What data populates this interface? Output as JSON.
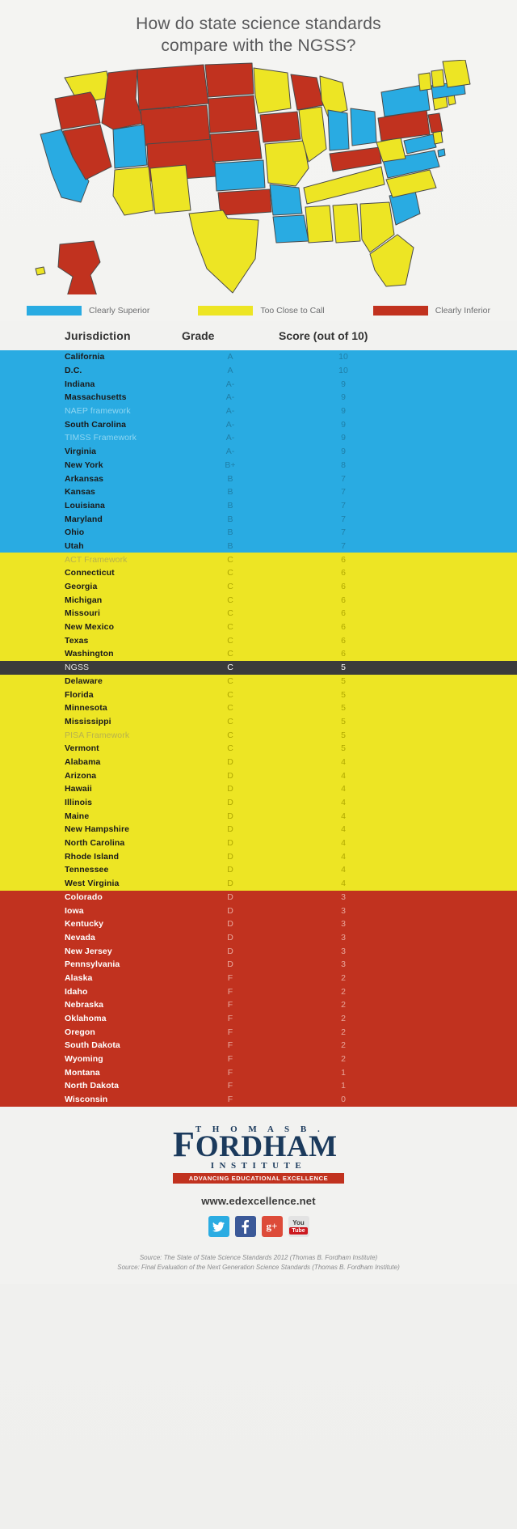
{
  "title": {
    "line1": "How do state science standards",
    "line2": "compare with the NGSS?"
  },
  "colors": {
    "superior": "#29ABE2",
    "close": "#EDE524",
    "inferior": "#C1321F",
    "ngss_row": "#3b3b3b",
    "background": "#f2f2f0"
  },
  "legend": {
    "items": [
      {
        "label": "Clearly Superior",
        "color": "#29ABE2"
      },
      {
        "label": "Too Close to Call",
        "color": "#EDE524"
      },
      {
        "label": "Clearly Inferior",
        "color": "#C1321F"
      }
    ]
  },
  "table": {
    "headers": {
      "jurisdiction": "Jurisdiction",
      "grade": "Grade",
      "score": "Score (out of 10)"
    }
  },
  "chart_data": {
    "type": "table",
    "title": "How do state science standards compare with the NGSS?",
    "columns": [
      "Jurisdiction",
      "Grade",
      "Score (out of 10)"
    ],
    "ylim": [
      0,
      10
    ],
    "legend": [
      "Clearly Superior",
      "Too Close to Call",
      "Clearly Inferior"
    ],
    "bands": [
      {
        "category": "Clearly Superior",
        "color": "#29ABE2",
        "rows": [
          {
            "name": "California",
            "grade": "A",
            "score": "10",
            "framework": false
          },
          {
            "name": "D.C.",
            "grade": "A",
            "score": "10",
            "framework": false
          },
          {
            "name": "Indiana",
            "grade": "A-",
            "score": "9",
            "framework": false
          },
          {
            "name": "Massachusetts",
            "grade": "A-",
            "score": "9",
            "framework": false
          },
          {
            "name": "NAEP framework",
            "grade": "A-",
            "score": "9",
            "framework": true
          },
          {
            "name": "South Carolina",
            "grade": "A-",
            "score": "9",
            "framework": false
          },
          {
            "name": "TIMSS Framework",
            "grade": "A-",
            "score": "9",
            "framework": true
          },
          {
            "name": "Virginia",
            "grade": "A-",
            "score": "9",
            "framework": false
          },
          {
            "name": "New York",
            "grade": "B+",
            "score": "8",
            "framework": false
          },
          {
            "name": "Arkansas",
            "grade": "B",
            "score": "7",
            "framework": false
          },
          {
            "name": "Kansas",
            "grade": "B",
            "score": "7",
            "framework": false
          },
          {
            "name": "Louisiana",
            "grade": "B",
            "score": "7",
            "framework": false
          },
          {
            "name": "Maryland",
            "grade": "B",
            "score": "7",
            "framework": false
          },
          {
            "name": "Ohio",
            "grade": "B",
            "score": "7",
            "framework": false
          },
          {
            "name": "Utah",
            "grade": "B",
            "score": "7",
            "framework": false
          }
        ]
      },
      {
        "category": "Too Close to Call",
        "color": "#EDE524",
        "rows": [
          {
            "name": "ACT Framework",
            "grade": "C",
            "score": "6",
            "framework": true
          },
          {
            "name": "Connecticut",
            "grade": "C",
            "score": "6",
            "framework": false
          },
          {
            "name": "Georgia",
            "grade": "C",
            "score": "6",
            "framework": false
          },
          {
            "name": "Michigan",
            "grade": "C",
            "score": "6",
            "framework": false
          },
          {
            "name": "Missouri",
            "grade": "C",
            "score": "6",
            "framework": false
          },
          {
            "name": "New Mexico",
            "grade": "C",
            "score": "6",
            "framework": false
          },
          {
            "name": "Texas",
            "grade": "C",
            "score": "6",
            "framework": false
          },
          {
            "name": "Washington",
            "grade": "C",
            "score": "6",
            "framework": false
          }
        ]
      },
      {
        "category": "NGSS",
        "color": "#3b3b3b",
        "highlight": true,
        "rows": [
          {
            "name": "NGSS",
            "grade": "C",
            "score": "5",
            "framework": true
          }
        ]
      },
      {
        "category": "Too Close to Call",
        "color": "#EDE524",
        "rows": [
          {
            "name": "Delaware",
            "grade": "C",
            "score": "5",
            "framework": false
          },
          {
            "name": "Florida",
            "grade": "C",
            "score": "5",
            "framework": false
          },
          {
            "name": "Minnesota",
            "grade": "C",
            "score": "5",
            "framework": false
          },
          {
            "name": "Mississippi",
            "grade": "C",
            "score": "5",
            "framework": false
          },
          {
            "name": "PISA Framework",
            "grade": "C",
            "score": "5",
            "framework": true
          },
          {
            "name": "Vermont",
            "grade": "C",
            "score": "5",
            "framework": false
          },
          {
            "name": "Alabama",
            "grade": "D",
            "score": "4",
            "framework": false
          },
          {
            "name": "Arizona",
            "grade": "D",
            "score": "4",
            "framework": false
          },
          {
            "name": "Hawaii",
            "grade": "D",
            "score": "4",
            "framework": false
          },
          {
            "name": "Illinois",
            "grade": "D",
            "score": "4",
            "framework": false
          },
          {
            "name": "Maine",
            "grade": "D",
            "score": "4",
            "framework": false
          },
          {
            "name": "New Hampshire",
            "grade": "D",
            "score": "4",
            "framework": false
          },
          {
            "name": "North Carolina",
            "grade": "D",
            "score": "4",
            "framework": false
          },
          {
            "name": "Rhode Island",
            "grade": "D",
            "score": "4",
            "framework": false
          },
          {
            "name": "Tennessee",
            "grade": "D",
            "score": "4",
            "framework": false
          },
          {
            "name": "West Virginia",
            "grade": "D",
            "score": "4",
            "framework": false
          }
        ]
      },
      {
        "category": "Clearly Inferior",
        "color": "#C1321F",
        "rows": [
          {
            "name": "Colorado",
            "grade": "D",
            "score": "3",
            "framework": false
          },
          {
            "name": "Iowa",
            "grade": "D",
            "score": "3",
            "framework": false
          },
          {
            "name": "Kentucky",
            "grade": "D",
            "score": "3",
            "framework": false
          },
          {
            "name": "Nevada",
            "grade": "D",
            "score": "3",
            "framework": false
          },
          {
            "name": "New Jersey",
            "grade": "D",
            "score": "3",
            "framework": false
          },
          {
            "name": "Pennsylvania",
            "grade": "D",
            "score": "3",
            "framework": false
          },
          {
            "name": "Alaska",
            "grade": "F",
            "score": "2",
            "framework": false
          },
          {
            "name": "Idaho",
            "grade": "F",
            "score": "2",
            "framework": false
          },
          {
            "name": "Nebraska",
            "grade": "F",
            "score": "2",
            "framework": false
          },
          {
            "name": "Oklahoma",
            "grade": "F",
            "score": "2",
            "framework": false
          },
          {
            "name": "Oregon",
            "grade": "F",
            "score": "2",
            "framework": false
          },
          {
            "name": "South Dakota",
            "grade": "F",
            "score": "2",
            "framework": false
          },
          {
            "name": "Wyoming",
            "grade": "F",
            "score": "2",
            "framework": false
          },
          {
            "name": "Montana",
            "grade": "F",
            "score": "1",
            "framework": false
          },
          {
            "name": "North Dakota",
            "grade": "F",
            "score": "1",
            "framework": false
          },
          {
            "name": "Wisconsin",
            "grade": "F",
            "score": "0",
            "framework": false
          }
        ]
      }
    ]
  },
  "map": {
    "state_colors": {
      "WA": "#EDE524",
      "OR": "#C1321F",
      "CA": "#29ABE2",
      "NV": "#C1321F",
      "ID": "#C1321F",
      "MT": "#C1321F",
      "WY": "#C1321F",
      "UT": "#29ABE2",
      "AZ": "#EDE524",
      "CO": "#C1321F",
      "NM": "#EDE524",
      "ND": "#C1321F",
      "SD": "#C1321F",
      "NE": "#C1321F",
      "KS": "#29ABE2",
      "OK": "#C1321F",
      "TX": "#EDE524",
      "MN": "#EDE524",
      "IA": "#C1321F",
      "MO": "#EDE524",
      "AR": "#29ABE2",
      "LA": "#29ABE2",
      "WI": "#C1321F",
      "IL": "#EDE524",
      "MI": "#EDE524",
      "IN": "#29ABE2",
      "OH": "#29ABE2",
      "KY": "#C1321F",
      "TN": "#EDE524",
      "MS": "#EDE524",
      "AL": "#EDE524",
      "GA": "#EDE524",
      "FL": "#EDE524",
      "SC": "#29ABE2",
      "NC": "#EDE524",
      "VA": "#29ABE2",
      "WV": "#EDE524",
      "MD": "#29ABE2",
      "DE": "#EDE524",
      "PA": "#C1321F",
      "NJ": "#C1321F",
      "NY": "#29ABE2",
      "CT": "#EDE524",
      "RI": "#EDE524",
      "MA": "#29ABE2",
      "VT": "#EDE524",
      "NH": "#EDE524",
      "ME": "#EDE524",
      "AK": "#C1321F",
      "HI": "#EDE524",
      "DC": "#29ABE2"
    }
  },
  "footer": {
    "logo": {
      "thomas_b": "T H O M A S   B .",
      "f": "F",
      "ordham": "ORDHAM",
      "institute": "INSTITUTE",
      "tagline": "ADVANCING EDUCATIONAL EXCELLENCE"
    },
    "url": "www.edexcellence.net",
    "social": [
      {
        "name": "twitter",
        "glyph": "✉"
      },
      {
        "name": "facebook",
        "glyph": "f"
      },
      {
        "name": "google-plus",
        "glyph": "g+"
      },
      {
        "name": "youtube",
        "top": "You",
        "bottom": "Tube"
      }
    ],
    "sources": [
      "Source: The State of State Science Standards 2012 (Thomas B. Fordham Institute)",
      "Source: Final Evaluation of the Next Generation Science Standards (Thomas B. Fordham Institute)"
    ]
  }
}
